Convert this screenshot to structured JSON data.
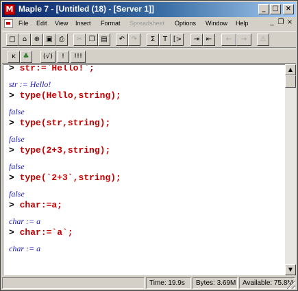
{
  "window": {
    "title": "Maple 7 - [Untitled (18) - [Server 1]]",
    "icon": "maple-leaf-icon",
    "controls": {
      "minimize": "_",
      "maximize": "□",
      "close": "×"
    }
  },
  "menubar": {
    "items": [
      "File",
      "Edit",
      "View",
      "Insert",
      "Format",
      "Spreadsheet",
      "Options",
      "Window",
      "Help"
    ],
    "disabled": [
      "Spreadsheet"
    ],
    "doc_controls": {
      "minimize": "_",
      "restore": "❐",
      "close": "×"
    }
  },
  "toolbar1": {
    "buttons": [
      {
        "name": "new-icon",
        "glyph": "□"
      },
      {
        "name": "open-icon",
        "glyph": "⌂"
      },
      {
        "name": "open-url-icon",
        "glyph": "⊕"
      },
      {
        "name": "save-icon",
        "glyph": "▣"
      },
      {
        "name": "print-icon",
        "glyph": "⎙"
      },
      {
        "name": "cut-icon",
        "glyph": "✂"
      },
      {
        "name": "copy-icon",
        "glyph": "❐"
      },
      {
        "name": "paste-icon",
        "glyph": "▤"
      },
      {
        "name": "undo-icon",
        "glyph": "↶"
      },
      {
        "name": "redo-icon",
        "glyph": "↷"
      },
      {
        "name": "sum-icon",
        "glyph": "Σ"
      },
      {
        "name": "text-icon",
        "glyph": "T"
      },
      {
        "name": "input-icon",
        "glyph": "[>"
      },
      {
        "name": "indent-icon",
        "glyph": "⇥"
      },
      {
        "name": "outdent-icon",
        "glyph": "⇤"
      },
      {
        "name": "back-icon",
        "glyph": "←"
      },
      {
        "name": "forward-icon",
        "glyph": "→"
      },
      {
        "name": "stop-icon",
        "glyph": "⚠"
      }
    ]
  },
  "toolbar2": {
    "buttons": [
      {
        "name": "math-icon",
        "glyph": "ĸ"
      },
      {
        "name": "maple-icon",
        "glyph": "♣"
      },
      {
        "name": "sqrt-icon",
        "glyph": "(√)"
      },
      {
        "name": "exclaim-icon",
        "glyph": "!"
      },
      {
        "name": "execute-all-icon",
        "glyph": "!!!"
      }
    ]
  },
  "worksheet": {
    "prompt_symbol": ">",
    "lines": [
      {
        "kind": "input",
        "text": "str:=`Hello!`;"
      },
      {
        "kind": "output",
        "text": "str := Hello!"
      },
      {
        "kind": "input",
        "text": "type(Hello,string);"
      },
      {
        "kind": "output",
        "text": "false"
      },
      {
        "kind": "input",
        "text": "type(str,string);"
      },
      {
        "kind": "output",
        "text": "false"
      },
      {
        "kind": "input",
        "text": "type(2+3,string);"
      },
      {
        "kind": "output",
        "text": "false"
      },
      {
        "kind": "input",
        "text": "type(`2+3`,string);"
      },
      {
        "kind": "output",
        "text": "false"
      },
      {
        "kind": "input",
        "text": "char:=a;"
      },
      {
        "kind": "output",
        "text": "char := a"
      },
      {
        "kind": "input",
        "text": "char:=`a`;"
      },
      {
        "kind": "output",
        "text": "char := a"
      }
    ]
  },
  "statusbar": {
    "time": "Time: 19.9s",
    "bytes": "Bytes: 3.69M",
    "available": "Available: 75.8M"
  }
}
